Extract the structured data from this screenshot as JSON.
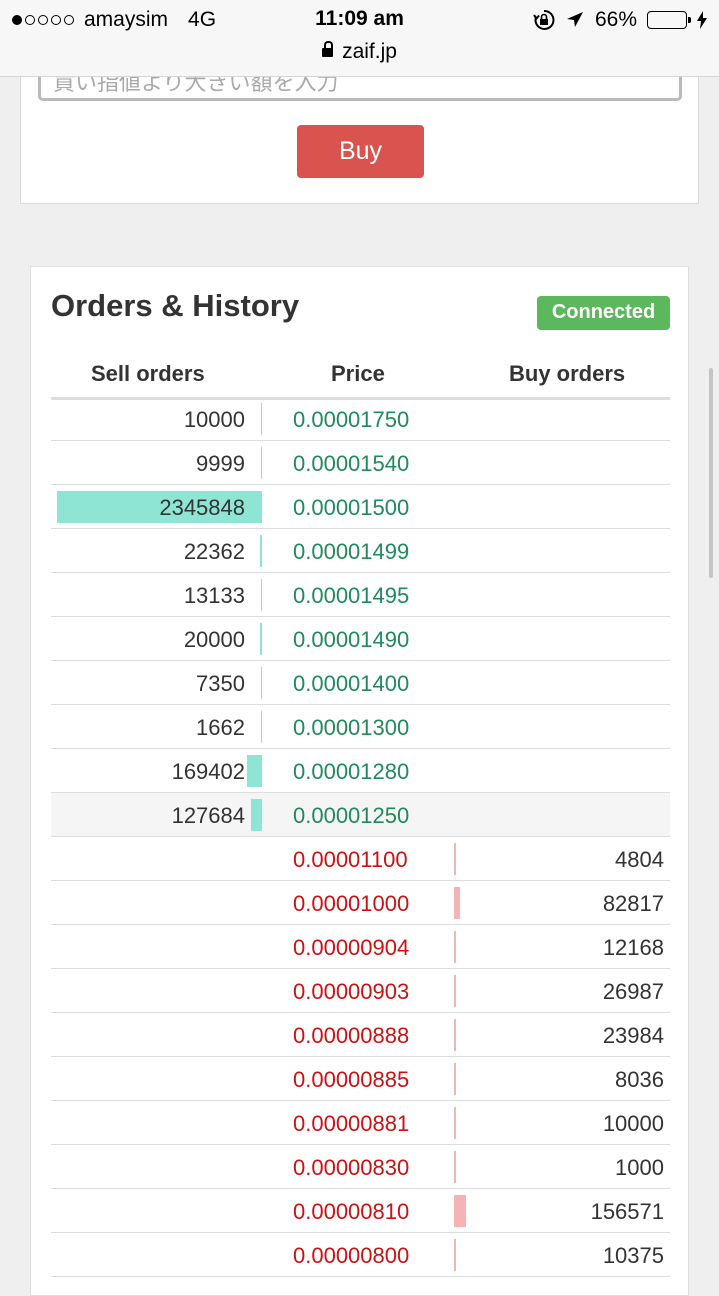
{
  "status_bar": {
    "carrier": "amaysim",
    "network": "4G",
    "time": "11:09 am",
    "url": "zaif.jp",
    "battery": "66%"
  },
  "buy_form": {
    "placeholder": "買い指値より大きい額を入力",
    "buy_label": "Buy"
  },
  "orders": {
    "title": "Orders & History",
    "status": "Connected",
    "headers": {
      "sell": "Sell orders",
      "price": "Price",
      "buy": "Buy orders"
    },
    "sell_rows": [
      {
        "qty": "10000",
        "price": "0.00001750",
        "bar": 0.0043
      },
      {
        "qty": "9999",
        "price": "0.00001540",
        "bar": 0.0043
      },
      {
        "qty": "2345848",
        "price": "0.00001500",
        "bar": 1.0
      },
      {
        "qty": "22362",
        "price": "0.00001499",
        "bar": 0.0095
      },
      {
        "qty": "13133",
        "price": "0.00001495",
        "bar": 0.0056
      },
      {
        "qty": "20000",
        "price": "0.00001490",
        "bar": 0.0085
      },
      {
        "qty": "7350",
        "price": "0.00001400",
        "bar": 0.0031
      },
      {
        "qty": "1662",
        "price": "0.00001300",
        "bar": 0.0007
      },
      {
        "qty": "169402",
        "price": "0.00001280",
        "bar": 0.072
      },
      {
        "qty": "127684",
        "price": "0.00001250",
        "bar": 0.054
      }
    ],
    "buy_rows": [
      {
        "price": "0.00001100",
        "qty": "4804",
        "bar": 0.031
      },
      {
        "price": "0.00001000",
        "qty": "82817",
        "bar": 0.529
      },
      {
        "price": "0.00000904",
        "qty": "12168",
        "bar": 0.078
      },
      {
        "price": "0.00000903",
        "qty": "26987",
        "bar": 0.172
      },
      {
        "price": "0.00000888",
        "qty": "23984",
        "bar": 0.153
      },
      {
        "price": "0.00000885",
        "qty": "8036",
        "bar": 0.051
      },
      {
        "price": "0.00000881",
        "qty": "10000",
        "bar": 0.064
      },
      {
        "price": "0.00000830",
        "qty": "1000",
        "bar": 0.006
      },
      {
        "price": "0.00000810",
        "qty": "156571",
        "bar": 1.0
      },
      {
        "price": "0.00000800",
        "qty": "10375",
        "bar": 0.066
      }
    ]
  }
}
